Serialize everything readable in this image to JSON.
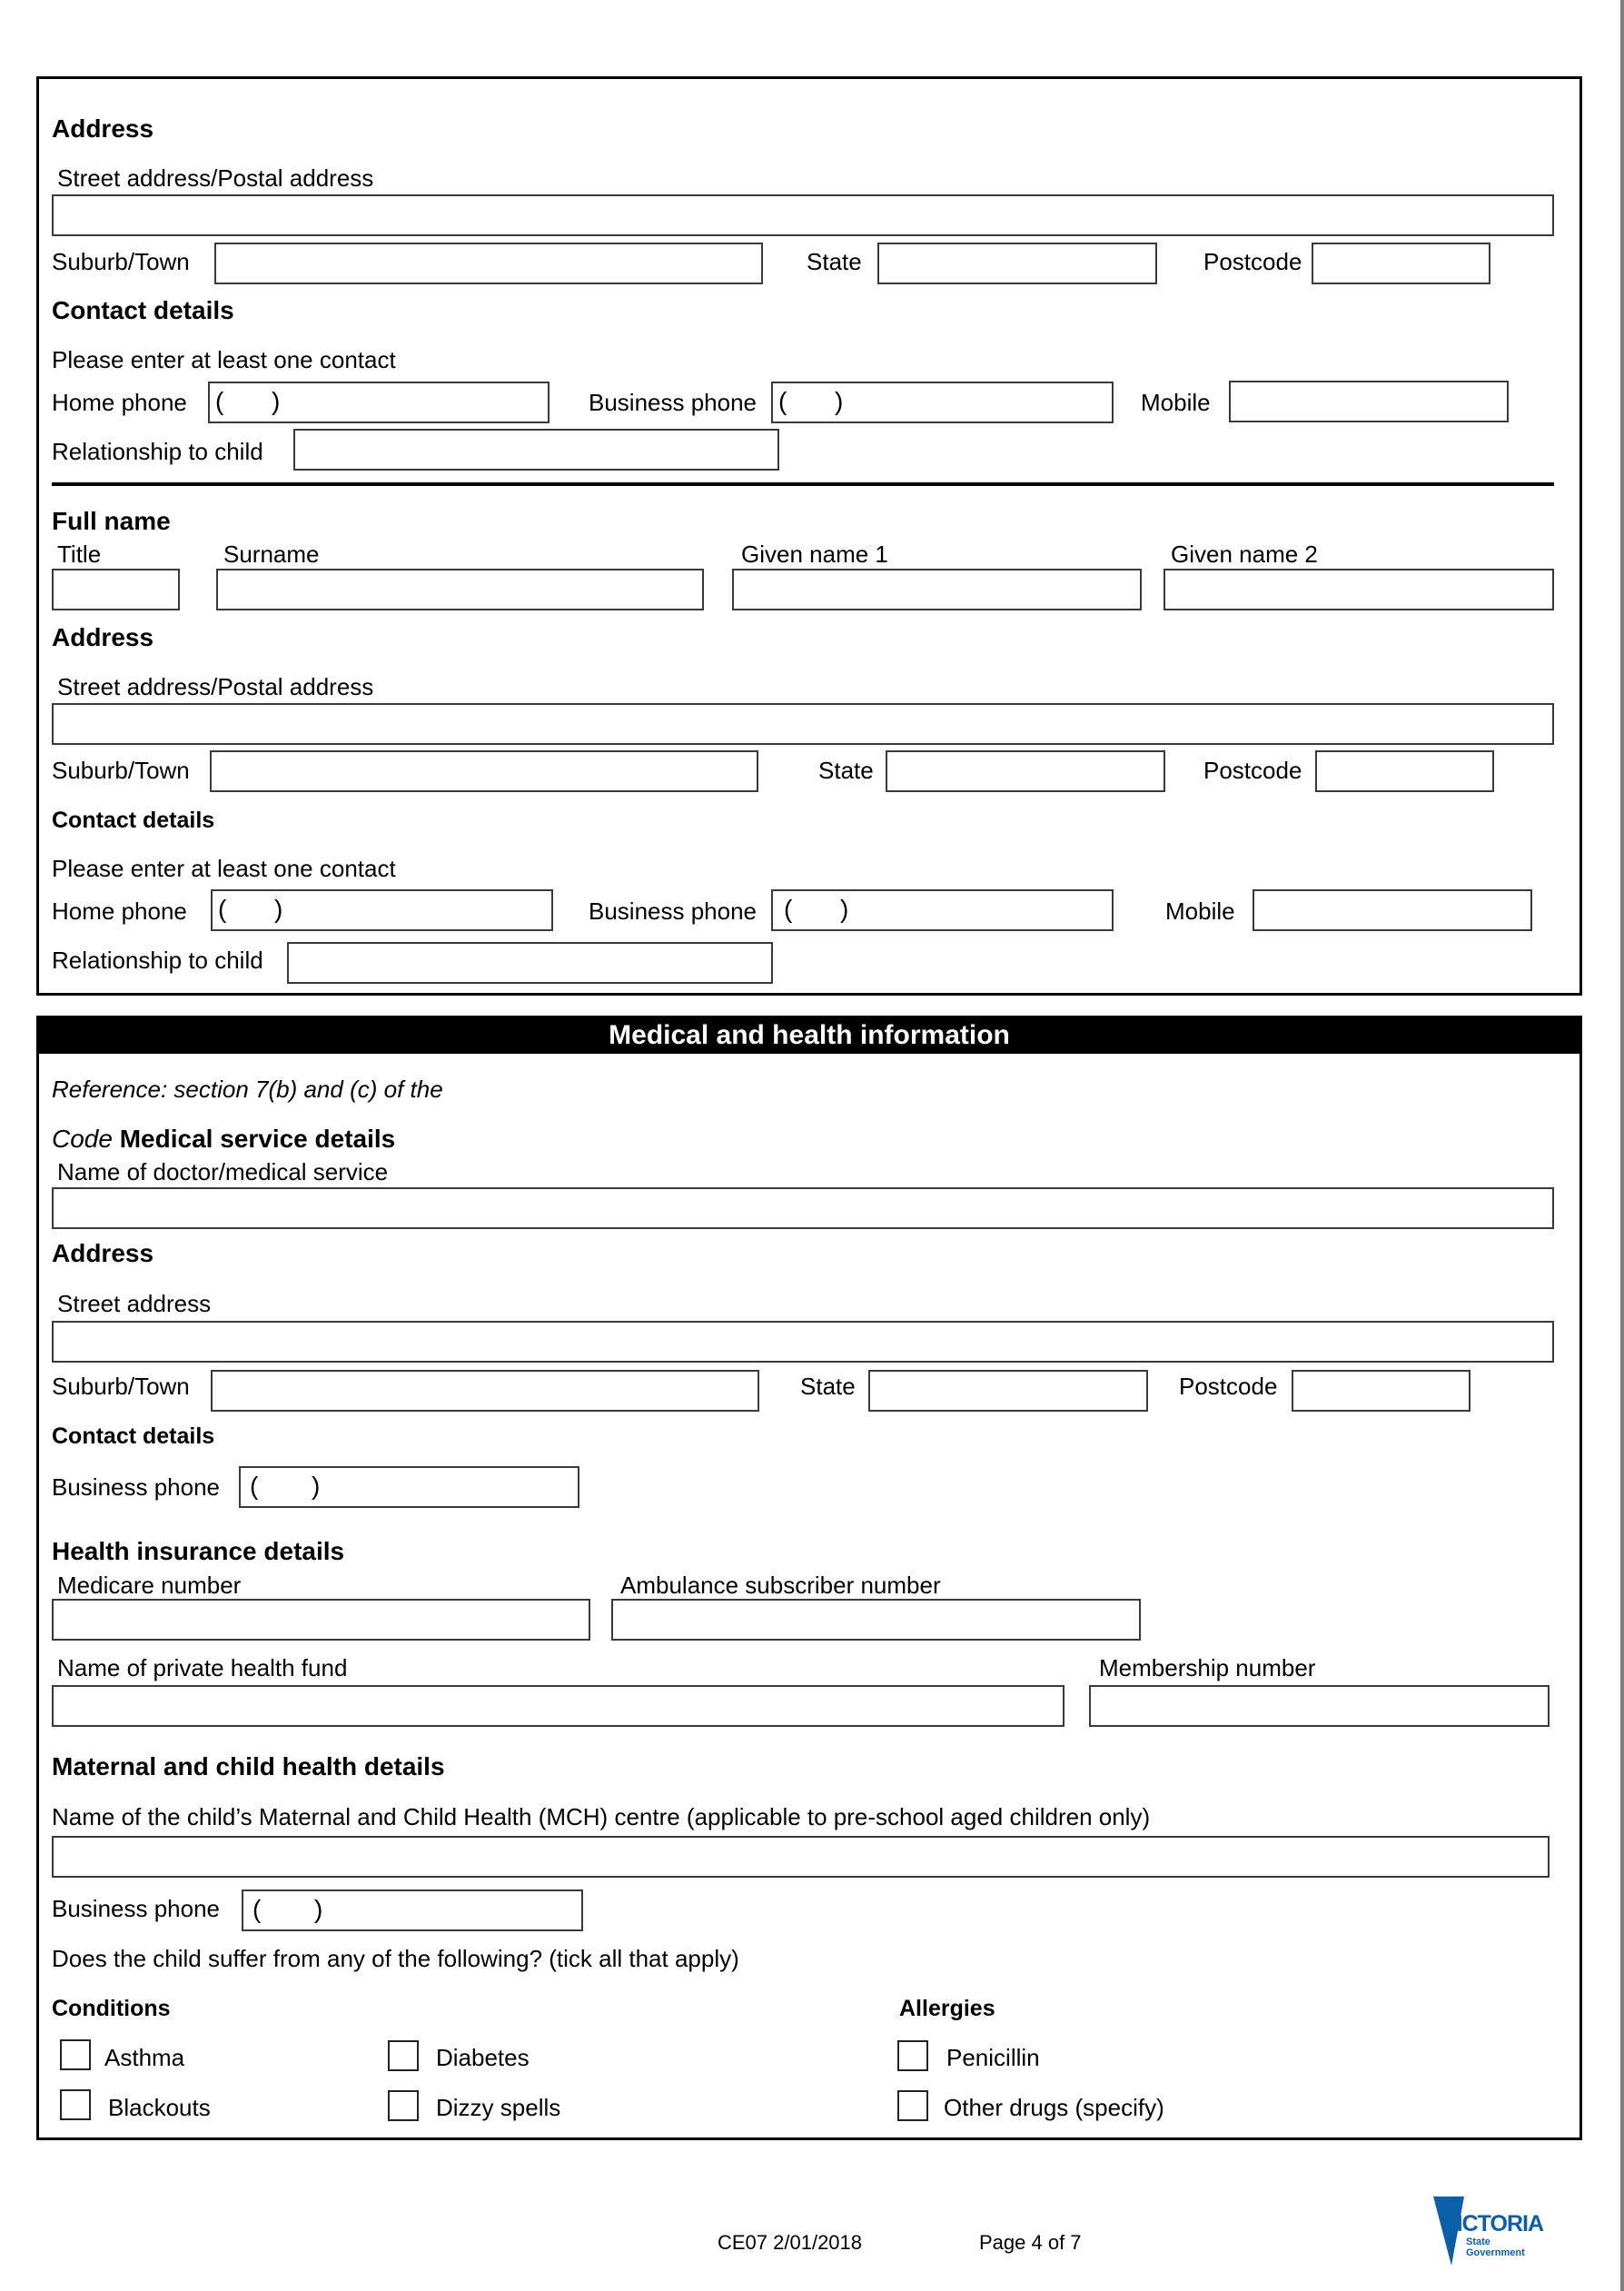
{
  "section1": {
    "address_heading": "Address",
    "street_label": "Street address/Postal address",
    "suburb_label": "Suburb/Town",
    "state_label": "State",
    "postcode_label": "Postcode",
    "contact_heading": "Contact details",
    "contact_note": "Please enter at least one contact",
    "home_phone_label": "Home phone",
    "business_phone_label": "Business phone",
    "mobile_label": "Mobile",
    "relationship_label": "Relationship to child",
    "phone_open": "(",
    "phone_close": ")"
  },
  "section2": {
    "fullname_heading": "Full name",
    "title_label": "Title",
    "surname_label": "Surname",
    "given1_label": "Given name 1",
    "given2_label": "Given name 2",
    "address_heading": "Address",
    "street_label": "Street address/Postal address",
    "suburb_label": "Suburb/Town",
    "state_label": "State",
    "postcode_label": "Postcode",
    "contact_heading": "Contact details",
    "contact_note": "Please enter at least one contact",
    "home_phone_label": "Home phone",
    "business_phone_label": "Business phone",
    "mobile_label": "Mobile",
    "relationship_label": "Relationship to child",
    "phone_open": "(",
    "phone_close": ")"
  },
  "medical": {
    "band_title": "Medical and health information",
    "reference_text": "Reference: section 7(b) and (c) of the",
    "code_word": "Code",
    "service_heading": "Medical service details",
    "doctor_label": "Name of doctor/medical service",
    "address_heading": "Address",
    "street_label": "Street address",
    "suburb_label": "Suburb/Town",
    "state_label": "State",
    "postcode_label": "Postcode",
    "contact_heading": "Contact details",
    "business_phone_label": "Business phone",
    "phone_open": "(",
    "phone_close": ")",
    "insurance_heading": "Health insurance details",
    "medicare_label": "Medicare number",
    "ambulance_label": "Ambulance subscriber number",
    "private_fund_label": "Name of private health fund",
    "membership_label": "Membership number",
    "mch_heading": "Maternal and child health details",
    "mch_centre_label": "Name of the child’s Maternal and Child Health (MCH) centre (applicable to pre-school aged children only)",
    "mch_phone_label": "Business phone",
    "suffer_question": "Does the child suffer from any of the following? (tick all that apply)",
    "conditions_heading": "Conditions",
    "conditions": [
      {
        "label": "Asthma",
        "checked": false
      },
      {
        "label": "Diabetes",
        "checked": false
      },
      {
        "label": "Blackouts",
        "checked": false
      },
      {
        "label": "Dizzy spells",
        "checked": false
      }
    ],
    "allergies_heading": "Allergies",
    "allergies": [
      {
        "label": "Penicillin",
        "checked": false
      },
      {
        "label": "Other drugs (specify)",
        "checked": false
      }
    ]
  },
  "footer": {
    "form_code": "CE07 2/01/2018",
    "page_label": "Page 4 of 7",
    "logo_word": "VICTORIA",
    "logo_sub1": "State",
    "logo_sub2": "Government",
    "logo_color": "#0b5ea8"
  }
}
